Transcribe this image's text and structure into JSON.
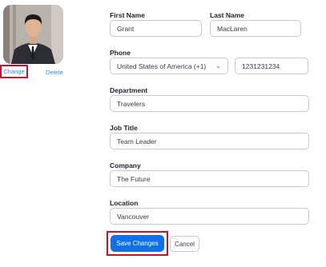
{
  "avatar": {
    "change_label": "Change",
    "delete_label": "Delete"
  },
  "form": {
    "first_name": {
      "label": "First Name",
      "value": "Grant"
    },
    "last_name": {
      "label": "Last Name",
      "value": "MacLaren"
    },
    "phone": {
      "label": "Phone",
      "country": "United States of America (+1)",
      "number": "1231231234"
    },
    "department": {
      "label": "Department",
      "value": "Travelers"
    },
    "job_title": {
      "label": "Job Title",
      "value": "Team Leader"
    },
    "company": {
      "label": "Company",
      "value": "The Future"
    },
    "location": {
      "label": "Location",
      "value": "Vancouver"
    }
  },
  "actions": {
    "save_label": "Save Changes",
    "cancel_label": "Cancel"
  },
  "colors": {
    "accent": "#0e71eb",
    "link": "#2d8cff",
    "highlight": "#c8102e"
  },
  "icons": {
    "select": "chevron-down-icon"
  }
}
